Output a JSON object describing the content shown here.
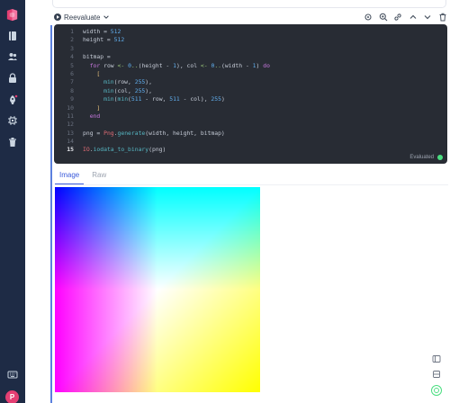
{
  "sidebar": {
    "avatar_initial": "P",
    "icons": [
      "logo-icon",
      "book-icon",
      "users-icon",
      "lock-icon",
      "rocket-icon",
      "cpu-icon",
      "trash-icon",
      "keyboard-icon"
    ]
  },
  "toolbar": {
    "reevaluate_label": "Reevaluate",
    "action_icons": [
      "gear-icon",
      "zoom-icon",
      "link-icon",
      "chevron-up-icon",
      "chevron-down-icon",
      "trash-icon"
    ]
  },
  "editor": {
    "active_line": 15,
    "status": "Evaluated",
    "status_color": "#4ade80",
    "lines": [
      "width = 512",
      "height = 512",
      "",
      "bitmap =",
      "  for row <- 0..(height - 1), col <- 0..(width - 1) do",
      "    [",
      "      min(row, 255),",
      "      min(col, 255),",
      "      min(min(511 - row, 511 - col), 255)",
      "    ]",
      "  end",
      "",
      "png = Png.generate(width, height, bitmap)",
      "",
      "IO.iodata_to_binary(png)"
    ]
  },
  "output": {
    "tabs": [
      "Image",
      "Raw"
    ],
    "active_tab": "Image"
  },
  "colors": {
    "accent": "#3b5bdb",
    "sidebar": "#1e2b45",
    "editor_bg": "#282c34"
  }
}
